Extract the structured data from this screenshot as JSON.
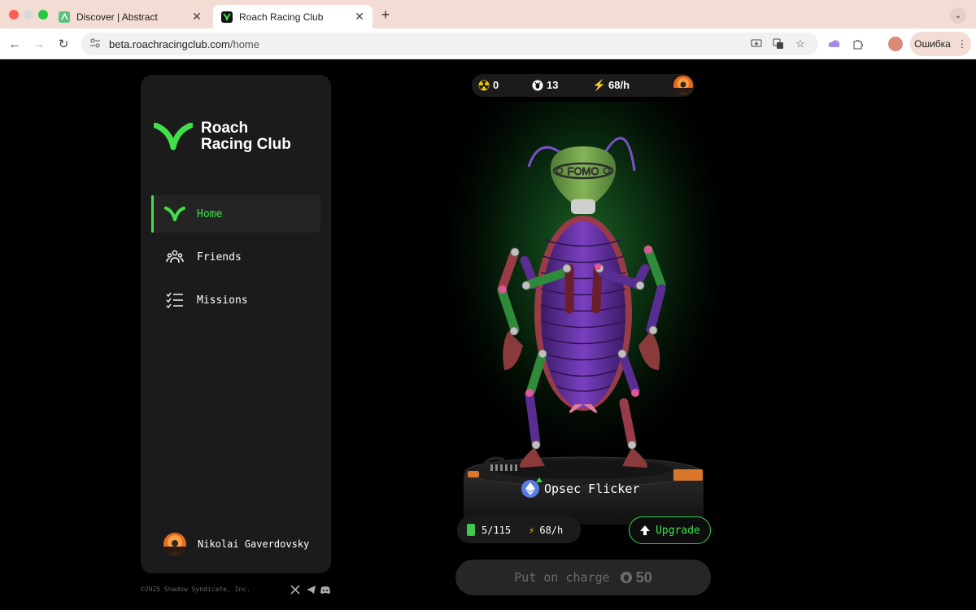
{
  "browser": {
    "tabs": [
      {
        "title": "Discover | Abstract",
        "active": false
      },
      {
        "title": "Roach Racing Club",
        "active": true
      }
    ],
    "url_host": "beta.roachracingclub.com",
    "url_path": "/home",
    "profile_label": "Ошибка"
  },
  "sidebar": {
    "brand_line1": "Roach",
    "brand_line2": "Racing Club",
    "nav": [
      {
        "label": "Home",
        "icon": "roach-logo-icon",
        "active": true
      },
      {
        "label": "Friends",
        "icon": "friends-icon",
        "active": false
      },
      {
        "label": "Missions",
        "icon": "checklist-icon",
        "active": false
      }
    ],
    "user_name": "Nikolai Gaverdovsky"
  },
  "footer": {
    "copyright": "©2025 Shadow Syndicate, Inc.",
    "social": [
      "x-icon",
      "telegram-icon",
      "discord-icon"
    ]
  },
  "stats": {
    "tokens": "0",
    "cockroach_coins": "13",
    "rate": "68/h"
  },
  "character": {
    "name": "Opsec Flicker",
    "headband_text": "FOMO",
    "battery": "5/115",
    "rate": "68/h",
    "upgrade_label": "Upgrade",
    "charge_label": "Put on charge",
    "charge_cost": "50"
  },
  "colors": {
    "accent": "#41e04a",
    "panel": "#1b1b1b",
    "background": "#000000"
  }
}
